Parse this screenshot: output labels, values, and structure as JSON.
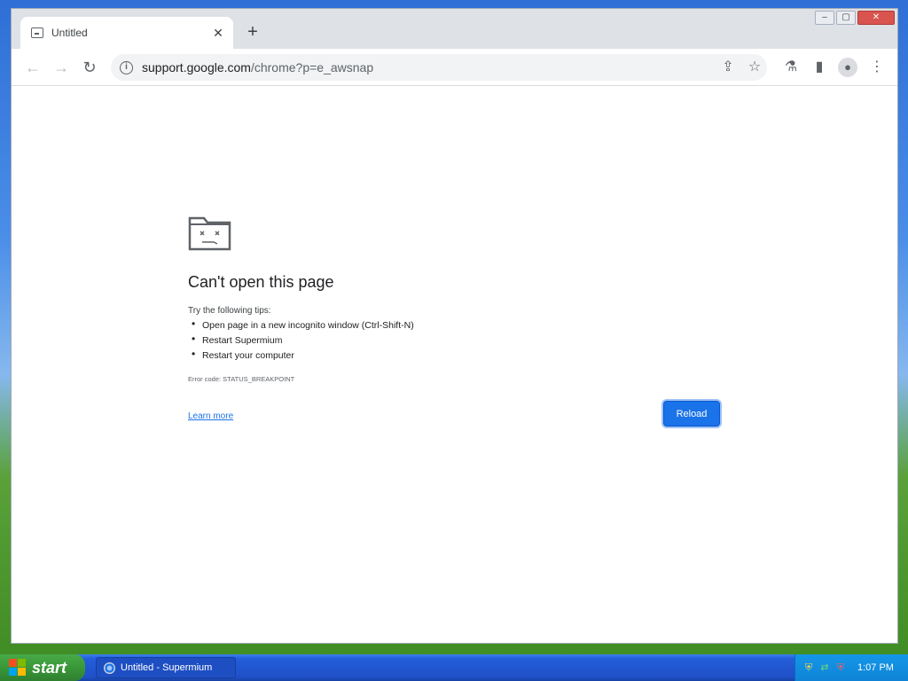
{
  "browser": {
    "tab": {
      "title": "Untitled",
      "close": "✕"
    },
    "new_tab": "+",
    "window_controls": {
      "minimize": "–",
      "maximize": "▢",
      "close": "✕"
    },
    "url_host": "support.google.com",
    "url_path": "/chrome?p=e_awsnap"
  },
  "icons": {
    "back": "←",
    "forward": "→",
    "reload": "↻",
    "info": "i",
    "share": "⇪",
    "star": "☆",
    "labs": "⚗",
    "side_panel": "▮",
    "profile": "●",
    "menu": "⋮"
  },
  "error_page": {
    "heading": "Can't open this page",
    "tips_intro": "Try the following tips:",
    "tips": [
      "Open page in a new incognito window (Ctrl-Shift-N)",
      "Restart Supermium",
      "Restart your computer"
    ],
    "error_code": "Error code: STATUS_BREAKPOINT",
    "learn_more": "Learn more",
    "reload": "Reload"
  },
  "taskbar": {
    "start": "start",
    "task_label": "Untitled - Supermium",
    "clock": "1:07 PM"
  },
  "colors": {
    "accent": "#1a73e8",
    "taskbar": "#245edb",
    "start": "#3a9a3a"
  }
}
